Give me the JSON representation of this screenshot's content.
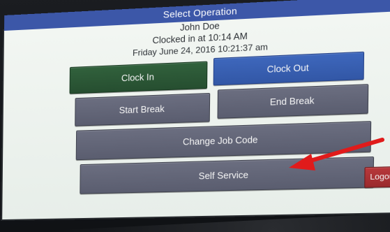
{
  "window": {
    "title": "Select Operation"
  },
  "employee": {
    "name": "John Doe",
    "clocked_in": "Clocked in at 10:14 AM",
    "datetime": "Friday June 24, 2016 10:21:37 am"
  },
  "buttons": {
    "clock_in": "Clock In",
    "clock_out": "Clock Out",
    "start_break": "Start Break",
    "end_break": "End Break",
    "change_job_code": "Change Job Code",
    "self_service": "Self Service",
    "logout": "Logout"
  },
  "colors": {
    "title_bar": "#3c57a8",
    "clock_in": "#2b5836",
    "clock_out": "#3a62b5",
    "gray_button": "#62657a",
    "logout": "#a83033",
    "annotation_arrow": "#e01b1b"
  }
}
